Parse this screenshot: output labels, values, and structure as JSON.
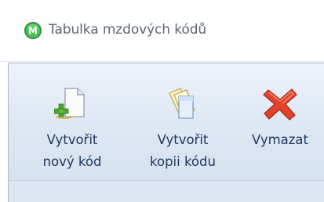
{
  "window": {
    "title": "Tabulka mzdových kódů",
    "app_icon_letter": "M",
    "app_icon_color": "#3fae49"
  },
  "ribbon": {
    "background": "#dce6f2",
    "label_color": "#20385e",
    "buttons": [
      {
        "label": "Vytvořit\nnový kód",
        "icon": "new-document-icon"
      },
      {
        "label": "Vytvořit\nkopii kódu",
        "icon": "copy-documents-icon"
      },
      {
        "label": "Vymazat",
        "icon": "delete-x-icon",
        "accent": "#e0432a"
      }
    ]
  }
}
